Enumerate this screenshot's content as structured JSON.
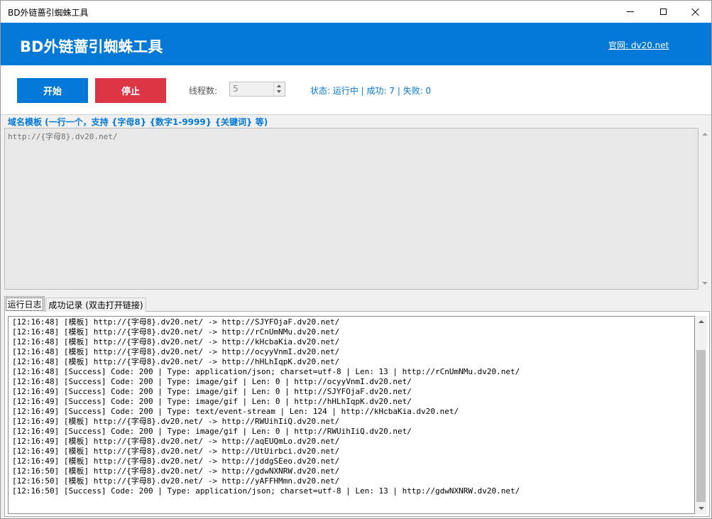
{
  "window": {
    "title": "BD外链蔷引蜘蛛工具"
  },
  "header": {
    "app_title": "BD外链蔷引蜘蛛工具",
    "site_link": "官网: dv20.net"
  },
  "controls": {
    "start_label": "开始",
    "stop_label": "停止",
    "threads_label": "线程数:",
    "threads_value": "5",
    "status_text": "状态: 运行中 | 成功: 7 | 失败: 0"
  },
  "template": {
    "label": "域名模板 (一行一个，支持 {字母8} {数字1-9999} {关键词} 等)",
    "value": "http://{字母8}.dv20.net/"
  },
  "tabs": [
    {
      "label": "运行日志",
      "active": true
    },
    {
      "label": "成功记录 (双击打开链接)",
      "active": false
    }
  ],
  "log": [
    "[12:16:48] [模板] http://{字母8}.dv20.net/ -> http://SJYFOjaF.dv20.net/",
    "[12:16:48] [模板] http://{字母8}.dv20.net/ -> http://rCnUmNMu.dv20.net/",
    "[12:16:48] [模板] http://{字母8}.dv20.net/ -> http://kHcbaKia.dv20.net/",
    "[12:16:48] [模板] http://{字母8}.dv20.net/ -> http://ocyyVnmI.dv20.net/",
    "[12:16:48] [模板] http://{字母8}.dv20.net/ -> http://hHLhIqpK.dv20.net/",
    "[12:16:48] [Success] Code: 200 | Type: application/json; charset=utf-8 | Len: 13 | http://rCnUmNMu.dv20.net/",
    "[12:16:48] [Success] Code: 200 | Type: image/gif | Len: 0 | http://ocyyVnmI.dv20.net/",
    "[12:16:49] [Success] Code: 200 | Type: image/gif | Len: 0 | http://SJYFOjaF.dv20.net/",
    "[12:16:49] [Success] Code: 200 | Type: image/gif | Len: 0 | http://hHLhIqpK.dv20.net/",
    "[12:16:49] [Success] Code: 200 | Type: text/event-stream | Len: 124 | http://kHcbaKia.dv20.net/",
    "[12:16:49] [模板] http://{字母8}.dv20.net/ -> http://RWUihIiQ.dv20.net/",
    "[12:16:49] [Success] Code: 200 | Type: image/gif | Len: 0 | http://RWUihIiQ.dv20.net/",
    "[12:16:49] [模板] http://{字母8}.dv20.net/ -> http://aqEUQmLo.dv20.net/",
    "[12:16:49] [模板] http://{字母8}.dv20.net/ -> http://UtUirbci.dv20.net/",
    "[12:16:49] [模板] http://{字母8}.dv20.net/ -> http://jddgSEeo.dv20.net/",
    "[12:16:50] [模板] http://{字母8}.dv20.net/ -> http://gdwNXNRW.dv20.net/",
    "[12:16:50] [模板] http://{字母8}.dv20.net/ -> http://yAFFHMmn.dv20.net/",
    "[12:16:50] [Success] Code: 200 | Type: application/json; charset=utf-8 | Len: 13 | http://gdwNXNRW.dv20.net/"
  ],
  "colors": {
    "accent": "#0478d7",
    "stop": "#dc3545"
  },
  "icons": [
    "minimize-icon",
    "maximize-icon",
    "close-icon",
    "spin-up-icon",
    "spin-down-icon",
    "scroll-up-icon",
    "scroll-down-icon"
  ]
}
